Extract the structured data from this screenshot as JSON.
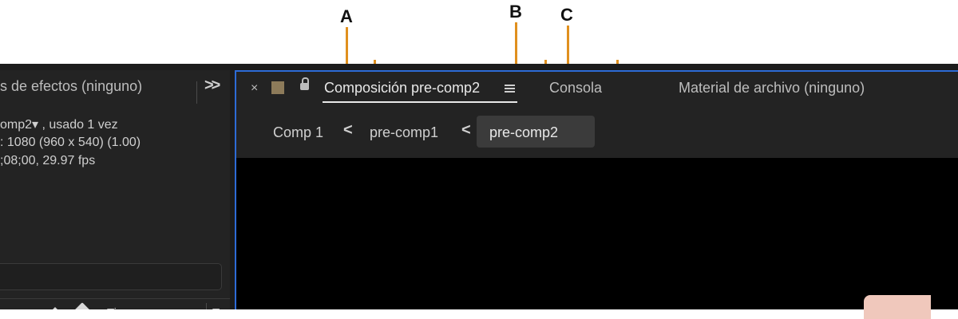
{
  "callouts": {
    "a": "A",
    "b": "B",
    "c": "C",
    "line_color": "#e0901e"
  },
  "project_panel": {
    "title": "s de efectos (ninguno)",
    "expand_icon": "double-chevron-right-icon",
    "info": {
      "line1": "omp2▾ , usado 1 vez",
      "line2": ": 1080  (960 x 540) (1.00)",
      "line3": ";08;00, 29.97 fps"
    },
    "columns": {
      "type": "Tipo",
      "next": "Ta"
    }
  },
  "composition_panel": {
    "border_color": "#2d6bd6",
    "tabs": {
      "close": "×",
      "active": "Composición pre-comp2",
      "console": "Consola",
      "footage": "Material de archivo (ninguno)"
    },
    "swatch_color": "#8d7b5a",
    "breadcrumbs": {
      "items": [
        "Comp 1",
        "pre-comp1",
        "pre-comp2"
      ],
      "separator": "<"
    }
  }
}
